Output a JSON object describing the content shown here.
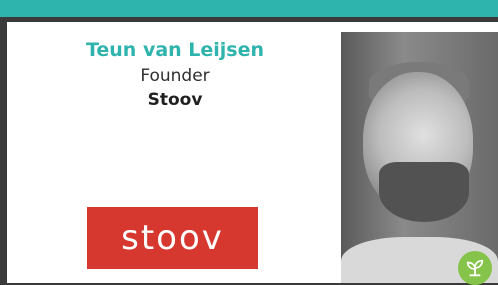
{
  "profile": {
    "name": "Teun van Leijsen",
    "role": "Founder",
    "company": "Stoov"
  },
  "logo": {
    "text": "stoov",
    "background": "#d6382f"
  },
  "colors": {
    "accent": "#2fb3ad",
    "badge": "#86c34a"
  },
  "icons": {
    "badge": "sprout-icon"
  }
}
